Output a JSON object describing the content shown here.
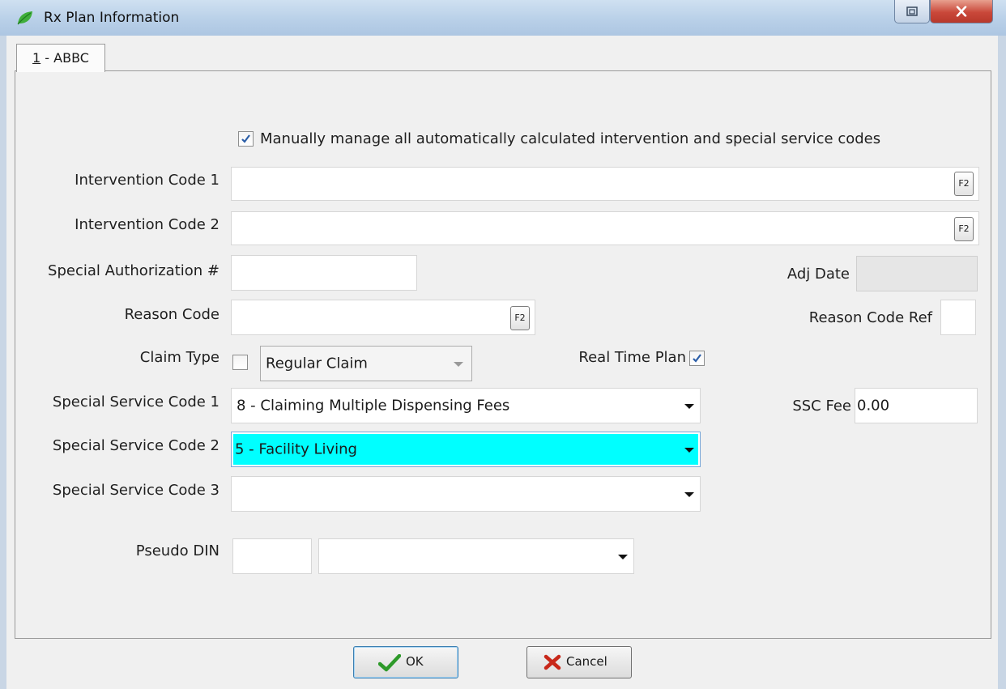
{
  "window": {
    "title": "Rx Plan Information"
  },
  "tab": {
    "label": "1 - ABBC",
    "mnemonic": "1",
    "rest": " - ABBC"
  },
  "manual_manage": {
    "label": "Manually manage all automatically calculated intervention and special service codes",
    "checked": true
  },
  "intervention_code_1": {
    "label": "Intervention Code 1",
    "value": "",
    "lookup_key": "F2"
  },
  "intervention_code_2": {
    "label": "Intervention Code 2",
    "value": "",
    "lookup_key": "F2"
  },
  "special_authorization": {
    "label": "Special Authorization #",
    "value": ""
  },
  "adj_date": {
    "label": "Adj Date",
    "value": ""
  },
  "reason_code": {
    "label": "Reason Code",
    "value": "",
    "lookup_key": "F2"
  },
  "reason_code_ref": {
    "label": "Reason Code Ref",
    "value": ""
  },
  "claim_type": {
    "label": "Claim Type",
    "checked": false,
    "selected": "Regular Claim"
  },
  "real_time_plan": {
    "label": "Real Time Plan",
    "checked": true
  },
  "ssc1": {
    "label": "Special Service Code 1",
    "selected": "8 - Claiming Multiple Dispensing Fees"
  },
  "ssc2": {
    "label": "Special Service Code 2",
    "selected": "5 - Facility Living",
    "highlight_color": "#00ffff"
  },
  "ssc3": {
    "label": "Special Service Code 3",
    "selected": ""
  },
  "ssc_fee": {
    "label": "SSC Fee",
    "value": "0.00"
  },
  "pseudo_din": {
    "label": "Pseudo DIN",
    "code": "",
    "selected": ""
  },
  "buttons": {
    "ok": "OK",
    "cancel": "Cancel"
  },
  "colors": {
    "accent_check": "#2b5ea8",
    "ok_check": "#2e9a2a",
    "cancel_x": "#c8281a"
  }
}
